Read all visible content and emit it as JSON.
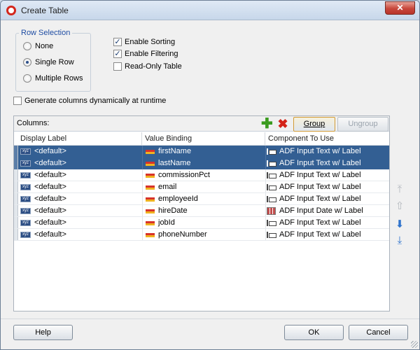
{
  "window": {
    "title": "Create Table",
    "close_label": "✕"
  },
  "row_selection": {
    "legend": "Row Selection",
    "options": [
      {
        "label": "None",
        "selected": false
      },
      {
        "label": "Single Row",
        "selected": true
      },
      {
        "label": "Multiple Rows",
        "selected": false
      }
    ]
  },
  "options": [
    {
      "label": "Enable Sorting",
      "checked": true
    },
    {
      "label": "Enable Filtering",
      "checked": true
    },
    {
      "label": "Read-Only Table",
      "checked": false
    }
  ],
  "generate_columns": {
    "label": "Generate columns dynamically at runtime",
    "checked": false
  },
  "columns_panel": {
    "label": "Columns:",
    "group_label": "Group",
    "ungroup_label": "Ungroup",
    "headers": [
      "Display Label",
      "Value Binding",
      "Component To Use"
    ],
    "rows": [
      {
        "display": "<default>",
        "binding": "firstName",
        "component": "ADF Input Text w/ Label",
        "component_icon": "input-text-icon",
        "selected": true
      },
      {
        "display": "<default>",
        "binding": "lastName",
        "component": "ADF Input Text w/ Label",
        "component_icon": "input-text-icon",
        "selected": true
      },
      {
        "display": "<default>",
        "binding": "commissionPct",
        "component": "ADF Input Text w/ Label",
        "component_icon": "input-text-icon",
        "selected": false
      },
      {
        "display": "<default>",
        "binding": "email",
        "component": "ADF Input Text w/ Label",
        "component_icon": "input-text-icon",
        "selected": false
      },
      {
        "display": "<default>",
        "binding": "employeeId",
        "component": "ADF Input Text w/ Label",
        "component_icon": "input-text-icon",
        "selected": false
      },
      {
        "display": "<default>",
        "binding": "hireDate",
        "component": "ADF Input Date w/ Label",
        "component_icon": "input-date-icon",
        "selected": false
      },
      {
        "display": "<default>",
        "binding": "jobId",
        "component": "ADF Input Text w/ Label",
        "component_icon": "input-text-icon",
        "selected": false
      },
      {
        "display": "<default>",
        "binding": "phoneNumber",
        "component": "ADF Input Text w/ Label",
        "component_icon": "input-text-icon",
        "selected": false
      }
    ]
  },
  "reorder_arrows": [
    "move-to-top-icon",
    "move-up-icon",
    "move-down-icon",
    "move-to-bottom-icon"
  ],
  "footer": {
    "help_label": "Help",
    "ok_label": "OK",
    "cancel_label": "Cancel"
  },
  "colors": {
    "selection": "#335f93",
    "group_border": "#d29b34",
    "title_accent": "#1f4da3"
  }
}
